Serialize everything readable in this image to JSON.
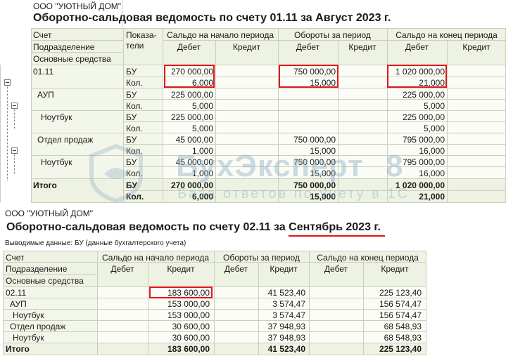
{
  "t1": {
    "org": "ООО \"УЮТНЫЙ ДОМ\"",
    "title": "Оборотно-сальдовая ведомость по счету 01.11 за Август 2023 г.",
    "h_account": "Счет",
    "h_dept": "Подразделение",
    "h_fixed": "Основные средства",
    "h_indicators": "Показа-\nтели",
    "h_open": "Сальдо на начало периода",
    "h_turn": "Обороты за период",
    "h_close": "Сальдо на конец периода",
    "h_debit": "Дебет",
    "h_credit": "Кредит",
    "rows": [
      {
        "name": "01.11",
        "ind1": "БУ",
        "ind2": "Кол.",
        "od1": "270 000,00",
        "od2": "6,000",
        "td1": "750 000,00",
        "td2": "15,000",
        "cd1": "1 020 000,00",
        "cd2": "21,000"
      },
      {
        "name": "АУП",
        "ind1": "БУ",
        "ind2": "Кол.",
        "od1": "225 000,00",
        "od2": "5,000",
        "td1": "",
        "td2": "",
        "cd1": "225 000,00",
        "cd2": "5,000"
      },
      {
        "name": "Ноутбук",
        "ind1": "БУ",
        "ind2": "Кол.",
        "od1": "225 000,00",
        "od2": "5,000",
        "td1": "",
        "td2": "",
        "cd1": "225 000,00",
        "cd2": "5,000"
      },
      {
        "name": "Отдел продаж",
        "ind1": "БУ",
        "ind2": "Кол.",
        "od1": "45 000,00",
        "od2": "1,000",
        "td1": "750 000,00",
        "td2": "15,000",
        "cd1": "795 000,00",
        "cd2": "16,000"
      },
      {
        "name": "Ноутбук",
        "ind1": "БУ",
        "ind2": "Кол.",
        "od1": "45 000,00",
        "od2": "1,000",
        "td1": "750 000,00",
        "td2": "15,000",
        "cd1": "795 000,00",
        "cd2": "16,000"
      }
    ],
    "total": {
      "name": "Итого",
      "ind1": "БУ",
      "ind2": "Кол.",
      "od1": "270 000,00",
      "od2": "6,000",
      "td1": "750 000,00",
      "td2": "15,000",
      "cd1": "1 020 000,00",
      "cd2": "21,000"
    }
  },
  "watermark": {
    "brand": "БухЭксперт",
    "badge": "8",
    "tagline": "База ответов по учету в 1С"
  },
  "t2": {
    "org": "ООО \"УЮТНЫЙ ДОМ\"",
    "title_main": "Оборотно-сальдовая ведомость по счету 02.11 за ",
    "title_period": "Сентябрь 2023 г.",
    "display_label": "Выводимые данные:",
    "display_value": "БУ (данные бухгалтерского учета)",
    "h_account": "Счет",
    "h_dept": "Подразделение",
    "h_fixed": "Основные средства",
    "h_open": "Сальдо на начало периода",
    "h_turn": "Обороты за период",
    "h_close": "Сальдо на конец периода",
    "h_debit": "Дебет",
    "h_credit": "Кредит",
    "rows": [
      {
        "name": "02.11",
        "oc": "183 600,00",
        "tc": "41 523,40",
        "cc": "225 123,40"
      },
      {
        "name": "АУП",
        "oc": "153 000,00",
        "tc": "3 574,47",
        "cc": "156 574,47"
      },
      {
        "name": "Ноутбук",
        "oc": "153 000,00",
        "tc": "3 574,47",
        "cc": "156 574,47"
      },
      {
        "name": "Отдел продаж",
        "oc": "30 600,00",
        "tc": "37 948,93",
        "cc": "68 548,93"
      },
      {
        "name": "Ноутбук",
        "oc": "30 600,00",
        "tc": "37 948,93",
        "cc": "68 548,93"
      }
    ],
    "total": {
      "name": "Итого",
      "oc": "183 600,00",
      "tc": "41 523,40",
      "cc": "225 123,40"
    }
  }
}
